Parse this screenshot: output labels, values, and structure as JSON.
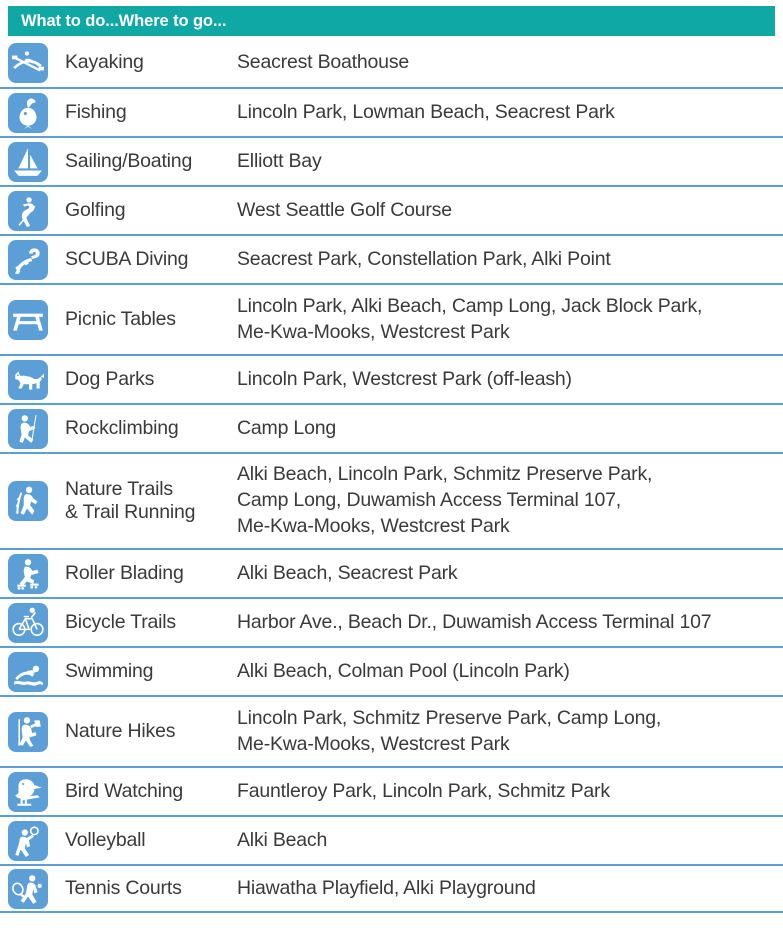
{
  "header": {
    "title": "What to do...Where to go..."
  },
  "colors": {
    "header_background": "#10a8a4",
    "header_text": "#ffffff",
    "icon_tile": "#5c9ed6",
    "divider": "#5c9ed6",
    "body_text": "#3a3a3a",
    "page_background": "#ffffff"
  },
  "rows": [
    {
      "icon": "kayaking-icon",
      "activity": "Kayaking",
      "location": "Seacrest Boathouse",
      "lines": 1
    },
    {
      "icon": "fishing-icon",
      "activity": "Fishing",
      "location": "Lincoln Park, Lowman Beach, Seacrest Park",
      "lines": 1
    },
    {
      "icon": "sailboat-icon",
      "activity": "Sailing/Boating",
      "location": "Elliott Bay",
      "lines": 1
    },
    {
      "icon": "golfing-icon",
      "activity": "Golfing",
      "location": "West Seattle Golf Course",
      "lines": 1
    },
    {
      "icon": "scuba-diving-icon",
      "activity": "SCUBA Diving",
      "location": "Seacrest Park, Constellation Park, Alki Point",
      "lines": 1
    },
    {
      "icon": "picnic-table-icon",
      "activity": "Picnic Tables",
      "location": "Lincoln Park, Alki Beach, Camp Long, Jack Block Park,\nMe-Kwa-Mooks, Westcrest Park",
      "lines": 2
    },
    {
      "icon": "dog-icon",
      "activity": "Dog Parks",
      "location": "Lincoln Park, Westcrest Park (off-leash)",
      "lines": 1
    },
    {
      "icon": "rockclimbing-icon",
      "activity": "Rockclimbing",
      "location": "Camp Long",
      "lines": 1
    },
    {
      "icon": "nature-trails-icon",
      "activity": "Nature Trails\n& Trail Running",
      "location": "Alki Beach, Lincoln Park, Schmitz Preserve Park,\nCamp Long, Duwamish Access Terminal 107,\nMe-Kwa-Mooks, Westcrest Park",
      "lines": 3
    },
    {
      "icon": "roller-blading-icon",
      "activity": "Roller Blading",
      "location": "Alki Beach, Seacrest Park",
      "lines": 1
    },
    {
      "icon": "bicycle-icon",
      "activity": "Bicycle Trails",
      "location": "Harbor Ave., Beach Dr., Duwamish Access Terminal 107",
      "lines": 1
    },
    {
      "icon": "swimming-icon",
      "activity": "Swimming",
      "location": "Alki Beach, Colman Pool (Lincoln Park)",
      "lines": 1
    },
    {
      "icon": "nature-hikes-icon",
      "activity": "Nature Hikes",
      "location": "Lincoln Park, Schmitz Preserve Park, Camp Long,\nMe-Kwa-Mooks, Westcrest Park",
      "lines": 2
    },
    {
      "icon": "bird-icon",
      "activity": "Bird Watching",
      "location": "Fauntleroy Park, Lincoln Park, Schmitz Park",
      "lines": 1
    },
    {
      "icon": "volleyball-icon",
      "activity": "Volleyball",
      "location": "Alki Beach",
      "lines": 1
    },
    {
      "icon": "tennis-icon",
      "activity": "Tennis Courts",
      "location": "Hiawatha Playfield, Alki Playground",
      "lines": 1
    }
  ]
}
